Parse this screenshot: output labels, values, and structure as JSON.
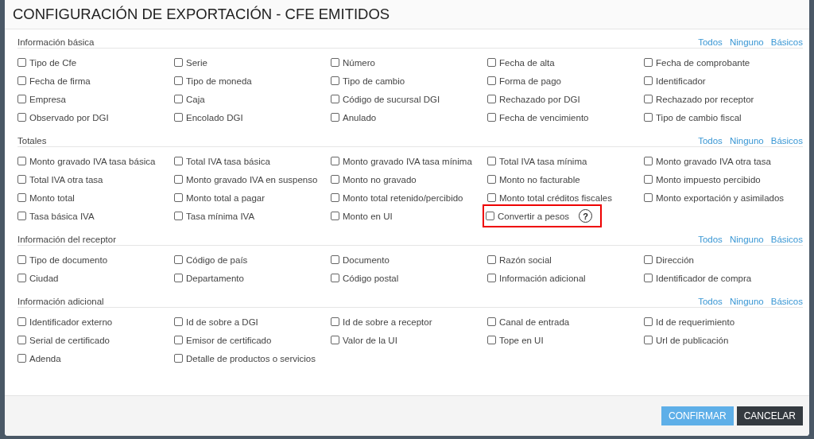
{
  "dialog": {
    "title": "CONFIGURACIÓN DE EXPORTACIÓN - CFE EMITIDOS"
  },
  "sections": [
    {
      "title": "Información básica",
      "actions": [
        "Todos",
        "Ninguno",
        "Básicos"
      ],
      "items": [
        {
          "label": "Tipo de Cfe",
          "checked": false
        },
        {
          "label": "Serie",
          "checked": false
        },
        {
          "label": "Número",
          "checked": false
        },
        {
          "label": "Fecha de alta",
          "checked": false
        },
        {
          "label": "Fecha de comprobante",
          "checked": false
        },
        {
          "label": "Fecha de firma",
          "checked": false
        },
        {
          "label": "Tipo de moneda",
          "checked": false
        },
        {
          "label": "Tipo de cambio",
          "checked": false
        },
        {
          "label": "Forma de pago",
          "checked": false
        },
        {
          "label": "Identificador",
          "checked": false
        },
        {
          "label": "Empresa",
          "checked": false
        },
        {
          "label": "Caja",
          "checked": false
        },
        {
          "label": "Código de sucursal DGI",
          "checked": false
        },
        {
          "label": "Rechazado por DGI",
          "checked": false
        },
        {
          "label": "Rechazado por receptor",
          "checked": false
        },
        {
          "label": "Observado por DGI",
          "checked": false
        },
        {
          "label": "Encolado DGI",
          "checked": false
        },
        {
          "label": "Anulado",
          "checked": false
        },
        {
          "label": "Fecha de vencimiento",
          "checked": false
        },
        {
          "label": "Tipo de cambio fiscal",
          "checked": false
        }
      ]
    },
    {
      "title": "Totales",
      "actions": [
        "Todos",
        "Ninguno",
        "Básicos"
      ],
      "items": [
        {
          "label": "Monto gravado IVA tasa básica",
          "checked": false
        },
        {
          "label": "Total IVA tasa básica",
          "checked": false
        },
        {
          "label": "Monto gravado IVA tasa mínima",
          "checked": false
        },
        {
          "label": "Total IVA tasa mínima",
          "checked": false
        },
        {
          "label": "Monto gravado IVA otra tasa",
          "checked": false
        },
        {
          "label": "Total IVA otra tasa",
          "checked": false
        },
        {
          "label": "Monto gravado IVA en suspenso",
          "checked": false
        },
        {
          "label": "Monto no gravado",
          "checked": false
        },
        {
          "label": "Monto no facturable",
          "checked": false
        },
        {
          "label": "Monto impuesto percibido",
          "checked": false
        },
        {
          "label": "Monto total",
          "checked": false
        },
        {
          "label": "Monto total a pagar",
          "checked": false
        },
        {
          "label": "Monto total retenido/percibido",
          "checked": false
        },
        {
          "label": "Monto total créditos fiscales",
          "checked": false
        },
        {
          "label": "Monto exportación y asimilados",
          "checked": false
        },
        {
          "label": "Tasa básica IVA",
          "checked": false
        },
        {
          "label": "Tasa mínima IVA",
          "checked": false
        },
        {
          "label": "Monto en UI",
          "checked": false
        },
        {
          "label": "Convertir a pesos",
          "checked": false,
          "highlighted": true,
          "help": "?"
        }
      ]
    },
    {
      "title": "Información del receptor",
      "actions": [
        "Todos",
        "Ninguno",
        "Básicos"
      ],
      "items": [
        {
          "label": "Tipo de documento",
          "checked": false
        },
        {
          "label": "Código de país",
          "checked": false
        },
        {
          "label": "Documento",
          "checked": false
        },
        {
          "label": "Razón social",
          "checked": false
        },
        {
          "label": "Dirección",
          "checked": false
        },
        {
          "label": "Ciudad",
          "checked": false
        },
        {
          "label": "Departamento",
          "checked": false
        },
        {
          "label": "Código postal",
          "checked": false
        },
        {
          "label": "Información adicional",
          "checked": false
        },
        {
          "label": "Identificador de compra",
          "checked": false
        }
      ]
    },
    {
      "title": "Información adicional",
      "actions": [
        "Todos",
        "Ninguno",
        "Básicos"
      ],
      "items": [
        {
          "label": "Identificador externo",
          "checked": false
        },
        {
          "label": "Id de sobre a DGI",
          "checked": false
        },
        {
          "label": "Id de sobre a receptor",
          "checked": false
        },
        {
          "label": "Canal de entrada",
          "checked": false
        },
        {
          "label": "Id de requerimiento",
          "checked": false
        },
        {
          "label": "Serial de certificado",
          "checked": false
        },
        {
          "label": "Emisor de certificado",
          "checked": false
        },
        {
          "label": "Valor de la UI",
          "checked": false
        },
        {
          "label": "Tope en UI",
          "checked": false
        },
        {
          "label": "Url de publicación",
          "checked": false
        },
        {
          "label": "Adenda",
          "checked": false
        },
        {
          "label": "Detalle de productos o servicios",
          "checked": false
        }
      ]
    }
  ],
  "buttons": [
    {
      "label": "CONFIRMAR",
      "kind": "primary"
    },
    {
      "label": "CANCELAR",
      "kind": "secondary"
    }
  ]
}
